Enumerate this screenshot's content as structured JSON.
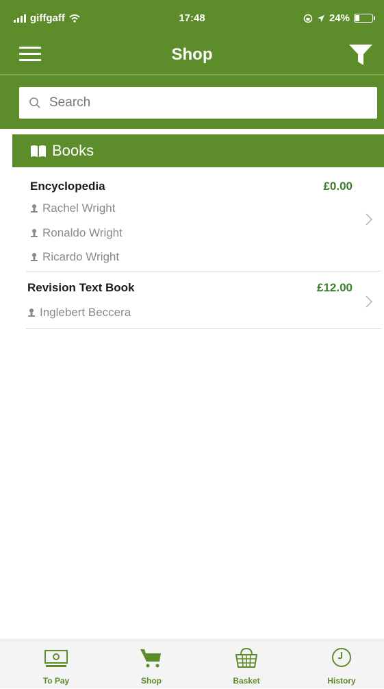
{
  "status_bar": {
    "carrier": "giffgaff",
    "time": "17:48",
    "battery": "24%",
    "battery_level": 0.24
  },
  "nav": {
    "title": "Shop",
    "menu_icon": "hamburger-menu-icon",
    "filter_icon": "filter-funnel-icon"
  },
  "search": {
    "placeholder": "Search",
    "value": ""
  },
  "section": {
    "title": "Books",
    "icon": "open-book-icon"
  },
  "items": [
    {
      "title": "Encyclopedia",
      "price": "£0.00",
      "authors": [
        "Rachel Wright",
        "Ronaldo Wright",
        "Ricardo Wright"
      ]
    },
    {
      "title": "Revision Text Book",
      "price": "£12.00",
      "authors": [
        "Inglebert Beccera"
      ]
    }
  ],
  "tabs": [
    {
      "label": "To Pay",
      "icon": "banknote-icon"
    },
    {
      "label": "Shop",
      "icon": "cart-icon"
    },
    {
      "label": "Basket",
      "icon": "basket-icon"
    },
    {
      "label": "History",
      "icon": "clock-icon"
    }
  ],
  "colors": {
    "brand_green": "#5d8d2a",
    "price_green": "#3d7d2b"
  }
}
